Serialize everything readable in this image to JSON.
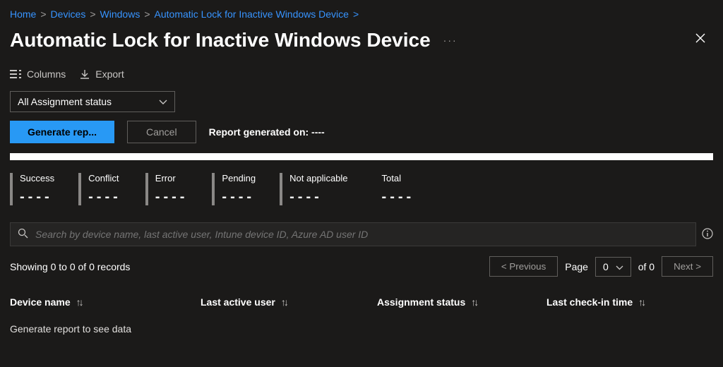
{
  "breadcrumb": {
    "items": [
      "Home",
      "Devices",
      "Windows",
      "Automatic Lock for Inactive Windows Device"
    ]
  },
  "header": {
    "title": "Automatic Lock for Inactive Windows Device"
  },
  "toolbar": {
    "columns_label": "Columns",
    "export_label": "Export"
  },
  "filter": {
    "selected": "All Assignment status"
  },
  "actions": {
    "generate_label": "Generate rep...",
    "cancel_label": "Cancel",
    "report_generated_label": "Report generated on: ----"
  },
  "stats": [
    {
      "label": "Success",
      "value": "----",
      "bar": true
    },
    {
      "label": "Conflict",
      "value": "----",
      "bar": true
    },
    {
      "label": "Error",
      "value": "----",
      "bar": true
    },
    {
      "label": "Pending",
      "value": "----",
      "bar": true
    },
    {
      "label": "Not applicable",
      "value": "----",
      "bar": true
    },
    {
      "label": "Total",
      "value": "----",
      "bar": false
    }
  ],
  "search": {
    "placeholder": "Search by device name, last active user, Intune device ID, Azure AD user ID"
  },
  "pagination": {
    "showing_text": "Showing 0 to 0 of 0 records",
    "prev_label": "< Previous",
    "page_label": "Page",
    "current_page": "0",
    "of_label": "of 0",
    "next_label": "Next >"
  },
  "table": {
    "columns": {
      "device": "Device name",
      "user": "Last active user",
      "status": "Assignment status",
      "checkin": "Last check-in time"
    },
    "empty_message": "Generate report to see data"
  }
}
